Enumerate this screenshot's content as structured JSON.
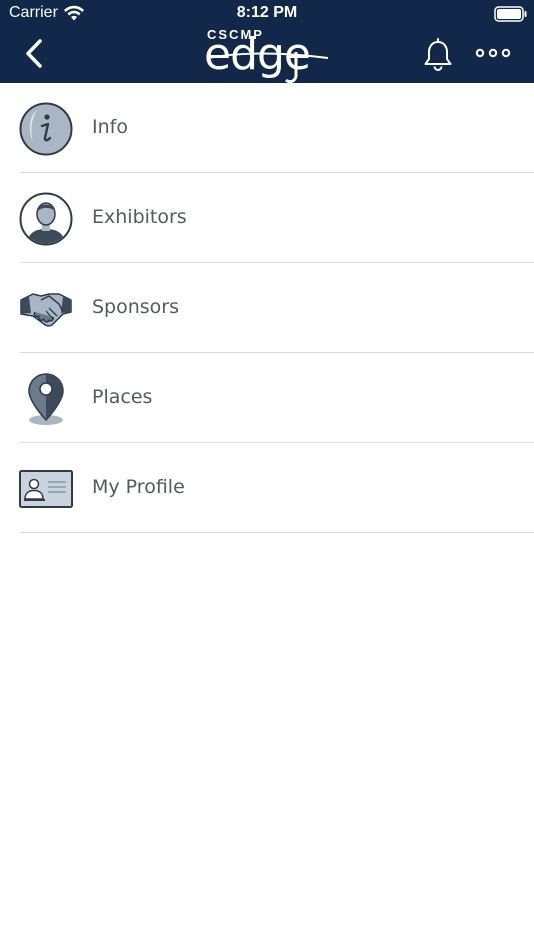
{
  "status_bar": {
    "carrier": "Carrier",
    "time": "8:12 PM"
  },
  "header": {
    "logo_small": "CSCMP",
    "logo_big": "edge",
    "background_color": "#11284a"
  },
  "menu": {
    "items": [
      {
        "label": "Info",
        "icon": "info-icon"
      },
      {
        "label": "Exhibitors",
        "icon": "person-icon"
      },
      {
        "label": "Sponsors",
        "icon": "handshake-icon"
      },
      {
        "label": "Places",
        "icon": "map-pin-icon"
      },
      {
        "label": "My Profile",
        "icon": "id-card-icon"
      }
    ]
  },
  "colors": {
    "icon_fill": "#a9b6c4",
    "icon_dark": "#3c4a5a",
    "label_text": "#555a60",
    "divider": "#dcdcdc"
  }
}
